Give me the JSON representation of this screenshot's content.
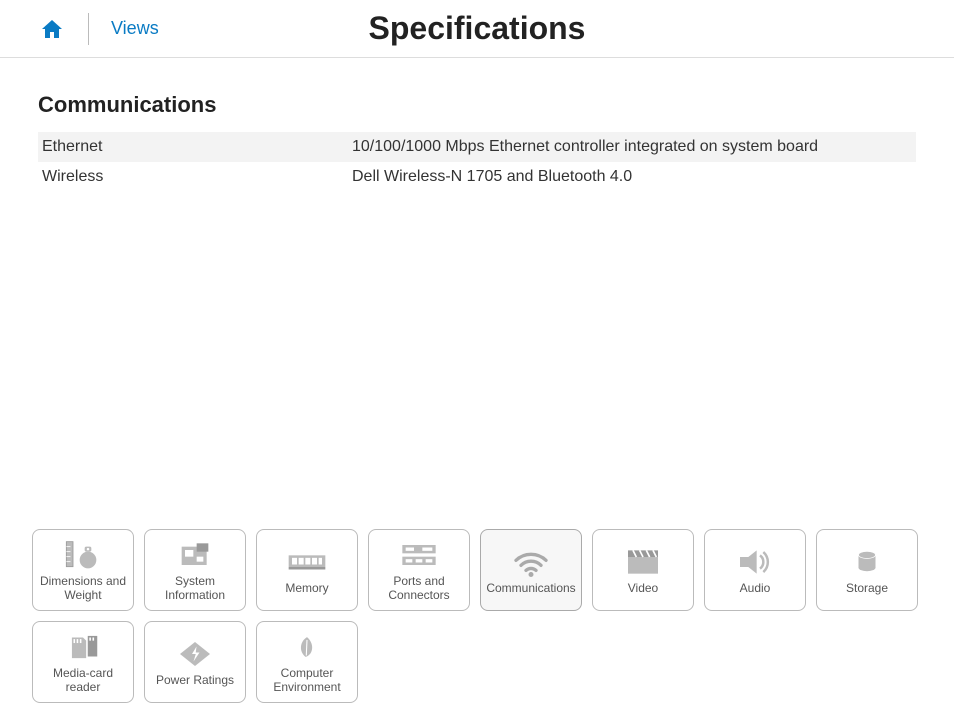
{
  "header": {
    "views_label": "Views",
    "page_title": "Specifications"
  },
  "section": {
    "title": "Communications",
    "rows": [
      {
        "label": "Ethernet",
        "value": "10/100/1000 Mbps Ethernet controller integrated on system board"
      },
      {
        "label": "Wireless",
        "value": "Dell Wireless-N 1705 and Bluetooth 4.0"
      }
    ]
  },
  "nav": {
    "tiles": [
      {
        "label": "Dimensions and Weight"
      },
      {
        "label": "System Information"
      },
      {
        "label": "Memory"
      },
      {
        "label": "Ports and Connectors"
      },
      {
        "label": "Communications"
      },
      {
        "label": "Video"
      },
      {
        "label": "Audio"
      },
      {
        "label": "Storage"
      },
      {
        "label": "Media-card reader"
      },
      {
        "label": "Power Ratings"
      },
      {
        "label": "Computer Environment"
      }
    ]
  }
}
